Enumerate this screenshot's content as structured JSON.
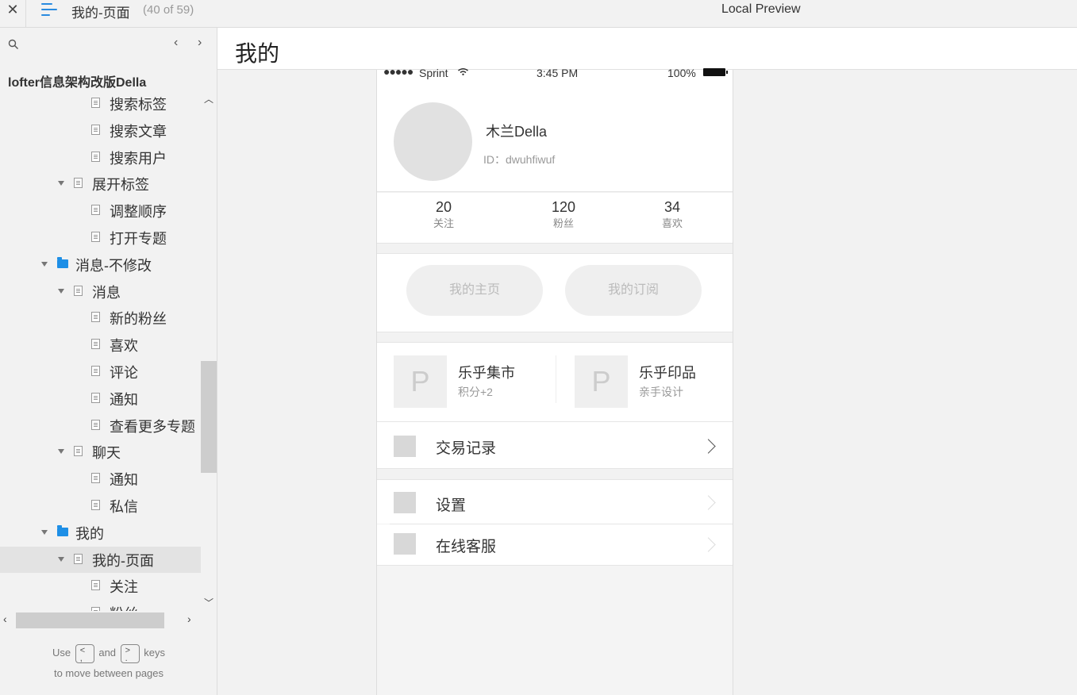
{
  "topbar": {
    "close": "✕",
    "page_name": "我的-页面",
    "page_count": "(40 of 59)",
    "preview_label": "Local Preview"
  },
  "sidebar": {
    "project_title": "lofter信息架构改版Della",
    "tree": [
      {
        "label": "搜索标签",
        "type": "page",
        "indent": 3
      },
      {
        "label": "搜索文章",
        "type": "page",
        "indent": 3
      },
      {
        "label": "搜索用户",
        "type": "page",
        "indent": 3
      },
      {
        "label": "展开标签",
        "type": "page",
        "indent": 2,
        "expanded": true
      },
      {
        "label": "调整顺序",
        "type": "page",
        "indent": 3
      },
      {
        "label": "打开专题",
        "type": "page",
        "indent": 3
      },
      {
        "label": "消息-不修改",
        "type": "folder",
        "indent": 1,
        "expanded": true
      },
      {
        "label": "消息",
        "type": "page",
        "indent": 2,
        "expanded": true
      },
      {
        "label": "新的粉丝",
        "type": "page",
        "indent": 3
      },
      {
        "label": "喜欢",
        "type": "page",
        "indent": 3
      },
      {
        "label": "评论",
        "type": "page",
        "indent": 3
      },
      {
        "label": "通知",
        "type": "page",
        "indent": 3
      },
      {
        "label": "查看更多专题",
        "type": "page",
        "indent": 3
      },
      {
        "label": "聊天",
        "type": "page",
        "indent": 2,
        "expanded": true
      },
      {
        "label": "通知",
        "type": "page",
        "indent": 3
      },
      {
        "label": "私信",
        "type": "page",
        "indent": 3
      },
      {
        "label": "我的",
        "type": "folder",
        "indent": 1,
        "expanded": true
      },
      {
        "label": "我的-页面",
        "type": "page",
        "indent": 2,
        "expanded": true,
        "selected": true
      },
      {
        "label": "关注",
        "type": "page",
        "indent": 3
      },
      {
        "label": "粉丝",
        "type": "page",
        "indent": 3
      }
    ],
    "hint": {
      "use": "Use",
      "key_prev": "<\n,",
      "and": "and",
      "key_next": ">\n.",
      "keys": "keys",
      "line2": "to move between pages"
    }
  },
  "main": {
    "title": "我的"
  },
  "phone": {
    "status": {
      "signal": "●●●●●",
      "carrier": "Sprint",
      "time": "3:45 PM",
      "battery": "100%"
    },
    "profile": {
      "name": "木兰Della",
      "id": "ID：dwuhfiwuf"
    },
    "stats": [
      {
        "num": "20",
        "label": "关注"
      },
      {
        "num": "120",
        "label": "粉丝"
      },
      {
        "num": "34",
        "label": "喜欢"
      }
    ],
    "buttons": {
      "home": "我的主页",
      "subscribe": "我的订阅"
    },
    "shops": [
      {
        "thumb": "P",
        "title": "乐乎集市",
        "sub": "积分+2"
      },
      {
        "thumb": "P",
        "title": "乐乎印品",
        "sub": "亲手设计"
      }
    ],
    "list": [
      {
        "label": "交易记录"
      },
      {
        "label": "设置"
      },
      {
        "label": "在线客服"
      }
    ]
  }
}
